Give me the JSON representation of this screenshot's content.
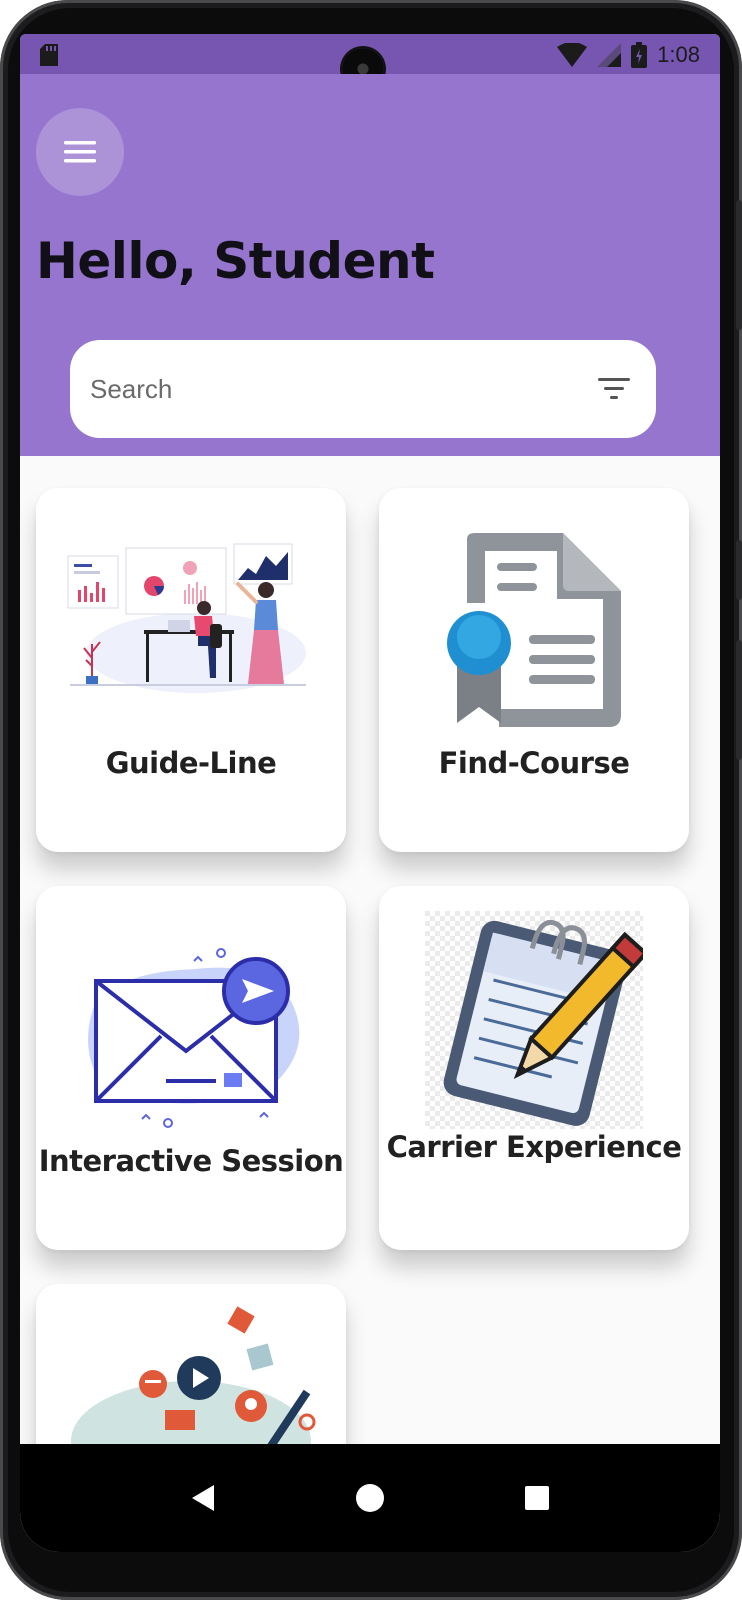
{
  "status_bar": {
    "time": "1:08",
    "icons": [
      "sd-card-icon",
      "wifi-icon",
      "signal-icon",
      "battery-icon"
    ]
  },
  "header": {
    "greeting": "Hello, Student",
    "menu_icon": "hamburger-menu-icon",
    "background_color": "#9575cd"
  },
  "search": {
    "placeholder": "Search",
    "value": "",
    "filter_icon": "filter-icon"
  },
  "cards": [
    {
      "label": "Guide-Line",
      "icon": "analytics-dashboard-illustration"
    },
    {
      "label": "Find-Course",
      "icon": "certificate-document-icon"
    },
    {
      "label": "Interactive Session",
      "icon": "envelope-send-illustration"
    },
    {
      "label": "Carrier Experience",
      "icon": "notepad-pencil-icon"
    },
    {
      "label": "",
      "icon": "education-media-illustration"
    }
  ],
  "nav_bar": {
    "back": "back-triangle-icon",
    "home": "home-circle-icon",
    "recents": "recents-square-icon"
  }
}
